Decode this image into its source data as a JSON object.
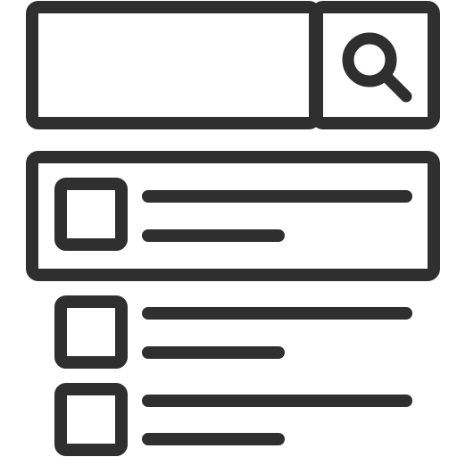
{
  "icon": {
    "name": "search-results-list-icon",
    "stroke_color": "#2f2f2f",
    "background_color": "#ffffff"
  },
  "search": {
    "input_value": "",
    "button_icon": "search-icon"
  },
  "results": [
    {
      "state": "selected",
      "icon": "checkbox-icon"
    },
    {
      "state": "default",
      "icon": "checkbox-icon"
    },
    {
      "state": "default",
      "icon": "checkbox-icon"
    }
  ]
}
